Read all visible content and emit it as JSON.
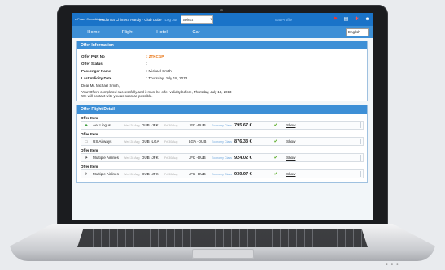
{
  "topbar": {
    "logo_text": "e-Power Consolidator",
    "user_links": "Madonna Chimera Handy · Club Cube",
    "login_link": "Log out",
    "select_value": "Select",
    "right_label": "Eat Profile",
    "icons": [
      "flag-icon",
      "document-icon",
      "settings-icon",
      "user-icon"
    ]
  },
  "nav": {
    "items": [
      "Home",
      "Flight",
      "Hotel",
      "Car"
    ],
    "language": "English"
  },
  "offer_info": {
    "header": "Offer Information",
    "rows": [
      {
        "label": "Offer PNR No",
        "value": ": ZTKCGP"
      },
      {
        "label": "Offer Status",
        "value": ":"
      },
      {
        "label": "Passenger Name",
        "value": ": Michael Smith"
      },
      {
        "label": "Last Validity Date",
        "value": ": Thursday, July 18, 2013"
      }
    ],
    "greeting": "Dear Mr. Michael Smith,",
    "message1": "Your Offers completed successfully and it must be offer-validity before, Thursday, July 18, 2013 .",
    "message2": "We will contact with you as soon as possible."
  },
  "flight_detail": {
    "header": "Offer Flight Detail",
    "item_label": "Offer Item",
    "show_label": "Show",
    "items": [
      {
        "airline": "Aer Lingus",
        "date1": "Wed 28 Aug",
        "route1": "DUB -JFK",
        "date2": "Fri 30 Aug",
        "route2": "JFK -DUB",
        "cls": "Economy Class",
        "price": "795.67 €",
        "icon": "shamrock-icon"
      },
      {
        "airline": "US Airways",
        "date1": "Wed 28 Aug",
        "route1": "DUB -LGA",
        "date2": "Fri 30 Aug",
        "route2": "LGA -DUB",
        "cls": "Economy Class",
        "price": "876.33 €",
        "icon": "usairways-icon"
      },
      {
        "airline": "Multiple Airlines",
        "date1": "Wed 28 Aug",
        "route1": "DUB -JFK",
        "date2": "Fri 30 Aug",
        "route2": "JFK -DUB",
        "cls": "Economy Class",
        "price": "924.02 €",
        "icon": "plane-icon"
      },
      {
        "airline": "Multiple Airlines",
        "date1": "Wed 28 Aug",
        "route1": "DUB -JFK",
        "date2": "Fri 30 Aug",
        "route2": "JFK -DUB",
        "cls": "Economy Class",
        "price": "939.97 €",
        "icon": "plane-icon"
      }
    ]
  },
  "colors": {
    "primary": "#1a73c8",
    "nav": "#3d8fd6",
    "pnr": "#e8700c",
    "check": "#5fae2e"
  }
}
